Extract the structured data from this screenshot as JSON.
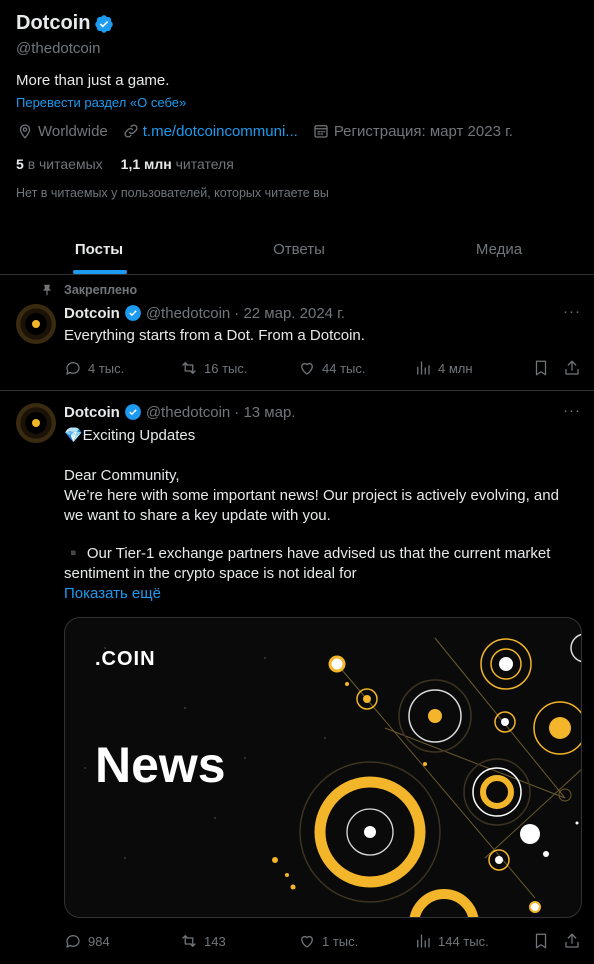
{
  "profile": {
    "name": "Dotcoin",
    "handle": "@thedotcoin",
    "bio": "More than just a game.",
    "translate_link": "Перевести раздел «О себе»",
    "location": "Worldwide",
    "website": "t.me/dotcoincommuni...",
    "joined": "Регистрация: март 2023 г.",
    "following_count": "5",
    "following_label": "в читаемых",
    "followers_count": "1,1 млн",
    "followers_label": "читателя",
    "followed_by_note": "Нет в читаемых у пользователей, которых читаете вы"
  },
  "tabs": [
    {
      "label": "Посты",
      "active": true
    },
    {
      "label": "Ответы",
      "active": false
    },
    {
      "label": "Медиа",
      "active": false
    }
  ],
  "posts": [
    {
      "pinned_label": "Закреплено",
      "name": "Dotcoin",
      "handle": "@thedotcoin",
      "date": "· 22 мар. 2024 г.",
      "text": "Everything starts from a Dot. From a Dotcoin.",
      "replies": "4 тыс.",
      "reposts": "16 тыс.",
      "likes": "44 тыс.",
      "views": "4 млн"
    },
    {
      "name": "Dotcoin",
      "handle": "@thedotcoin",
      "date": "· 13 мар.",
      "line1": "💎Exciting Updates",
      "line2": "Dear Community,",
      "line3": "We’re here with some important news! Our project is actively evolving, and",
      "line4": "we want to share a key update with you.",
      "line5": "▪️ Our Tier-1 exchange partners have advised us that the current market",
      "line6": "sentiment in the crypto space is not ideal for",
      "show_more": "Показать ещё",
      "image": {
        "brand": ".COIN",
        "headline": "News"
      },
      "replies": "984",
      "reposts": "143",
      "likes": "1 тыс.",
      "views": "144 тыс."
    }
  ],
  "colors": {
    "accent": "#1d9bf0",
    "brand_gold": "#f3b52a",
    "muted": "#71767b",
    "divider": "#2f3336"
  }
}
